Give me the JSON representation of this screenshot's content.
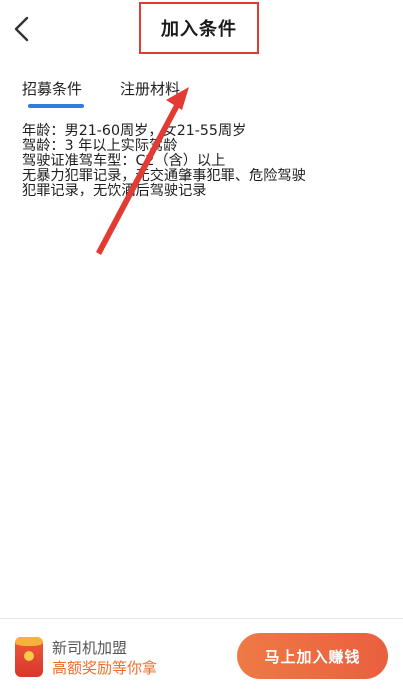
{
  "header": {
    "title": "加入条件"
  },
  "tabs": [
    {
      "label": "招募条件",
      "active": true
    },
    {
      "label": "注册材料",
      "active": false
    }
  ],
  "content": {
    "lines": [
      "年龄：男21-60周岁，女21-55周岁",
      "驾龄：3 年以上实际驾龄",
      "驾驶证准驾车型：C2（含）以上",
      "无暴力犯罪记录，无交通肇事犯罪、危险驾驶",
      "犯罪记录，无饮酒后驾驶记录"
    ]
  },
  "bottom_bar": {
    "promo_line1": "新司机加盟",
    "promo_line2": "高额奖励等你拿",
    "join_button": "马上加入赚钱"
  },
  "colors": {
    "accent_blue": "#2f7be0",
    "annotation_red": "#e23b33",
    "promo_orange": "#ef6f2c",
    "button_orange": "#ea5f3f"
  }
}
